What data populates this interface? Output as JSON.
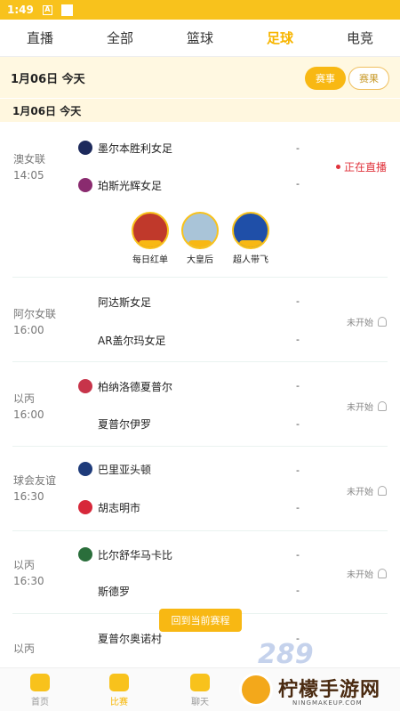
{
  "status_bar": {
    "time": "1:49",
    "icon_letter": "A"
  },
  "top_tabs": [
    {
      "label": "直播",
      "active": false
    },
    {
      "label": "全部",
      "active": false
    },
    {
      "label": "篮球",
      "active": false
    },
    {
      "label": "足球",
      "active": true
    },
    {
      "label": "电竞",
      "active": false
    }
  ],
  "date_bar": {
    "date": "1月06日 今天",
    "btn_schedule": "赛事",
    "btn_result": "赛果"
  },
  "section_date": "1月06日 今天",
  "matches": [
    {
      "league": "澳女联",
      "time": "14:05",
      "home": "墨尔本胜利女足",
      "away": "珀斯光辉女足",
      "home_score": "-",
      "away_score": "-",
      "status": "正在直播"
    },
    {
      "league": "阿尔女联",
      "time": "16:00",
      "home": "阿达斯女足",
      "away": "AR盖尔玛女足",
      "home_score": "-",
      "away_score": "-",
      "status": "未开始"
    },
    {
      "league": "以丙",
      "time": "16:00",
      "home": "柏纳洛德夏普尔",
      "away": "夏普尔伊罗",
      "home_score": "-",
      "away_score": "-",
      "status": "未开始"
    },
    {
      "league": "球会友谊",
      "time": "16:30",
      "home": "巴里亚头顿",
      "away": "胡志明市",
      "home_score": "-",
      "away_score": "-",
      "status": "未开始"
    },
    {
      "league": "以丙",
      "time": "16:30",
      "home": "比尔舒华马卡比",
      "away": "斯德罗",
      "home_score": "-",
      "away_score": "-",
      "status": "未开始"
    },
    {
      "league": "以丙",
      "time": "",
      "home": "夏普尔奥诺村",
      "away": "",
      "home_score": "-",
      "away_score": "",
      "status": ""
    }
  ],
  "anchors": [
    {
      "name": "每日红单",
      "icon": "anchor-avatar"
    },
    {
      "name": "大皇后",
      "icon": "anchor-avatar"
    },
    {
      "name": "超人带飞",
      "icon": "superman-avatar"
    }
  ],
  "back_button": "回到当前赛程",
  "bottom_nav": [
    {
      "label": "首页",
      "active": false
    },
    {
      "label": "比赛",
      "active": true
    },
    {
      "label": "聊天",
      "active": false
    }
  ],
  "watermark": {
    "text": "柠檬手游网",
    "sub": "NINGMAKEUP.COM",
    "overlay": "289"
  },
  "colors": {
    "accent": "#f8b813",
    "live": "#e0333c"
  }
}
